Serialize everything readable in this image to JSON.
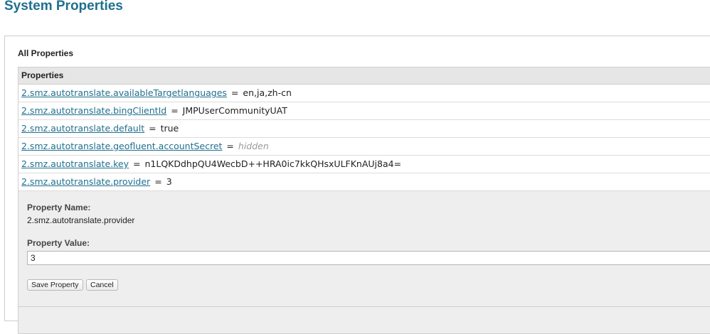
{
  "page": {
    "title": "System Properties"
  },
  "section": {
    "title": "All Properties"
  },
  "table": {
    "header": "Properties",
    "separator": "=",
    "rows": [
      {
        "name": "2.smz.autotranslate.availableTargetlanguages",
        "value": "en,ja,zh-cn",
        "hidden": false
      },
      {
        "name": "2.smz.autotranslate.bingClientId",
        "value": "JMPUserCommunityUAT",
        "hidden": false
      },
      {
        "name": "2.smz.autotranslate.default",
        "value": "true",
        "hidden": false
      },
      {
        "name": "2.smz.autotranslate.geofluent.accountSecret",
        "value": "hidden",
        "hidden": true
      },
      {
        "name": "2.smz.autotranslate.key",
        "value": "n1LQKDdhpQU4WecbD++HRA0ic7kkQHsxULFKnAUj8a4=",
        "hidden": false
      },
      {
        "name": "2.smz.autotranslate.provider",
        "value": "3",
        "hidden": false
      }
    ]
  },
  "editor": {
    "name_label": "Property Name:",
    "name_value": "2.smz.autotranslate.provider",
    "value_label": "Property Value:",
    "value_input": "3",
    "save_label": "Save Property",
    "cancel_label": "Cancel"
  },
  "colors": {
    "title": "#1f6f8f",
    "link": "#1f6f8f",
    "header_bg": "#e6e6e6",
    "editor_bg": "#eeeeee",
    "hidden_text": "#999999"
  }
}
